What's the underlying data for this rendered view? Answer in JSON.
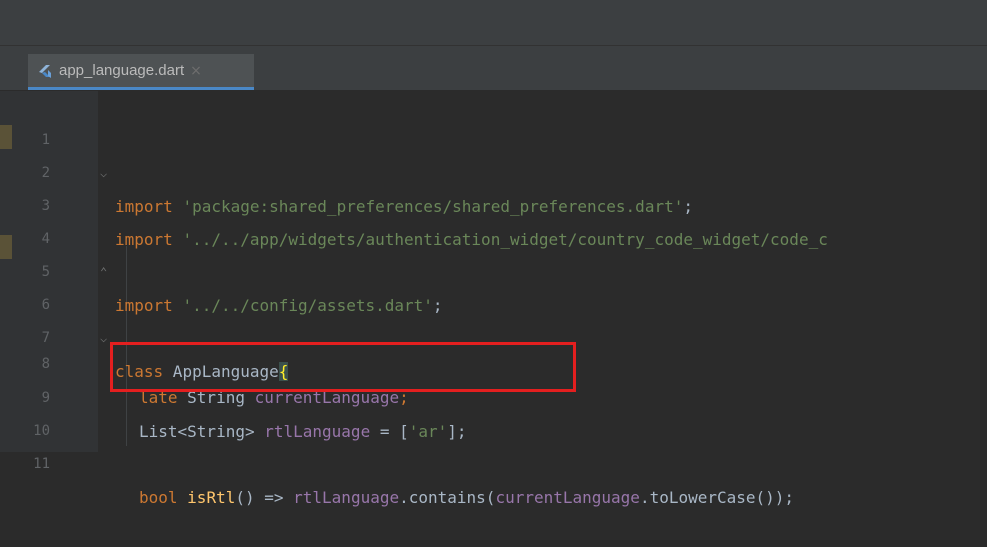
{
  "tab": {
    "filename": "app_language.dart",
    "close": "×",
    "icon": "flutter-dart-file-icon"
  },
  "lines": [
    {
      "n": "1"
    },
    {
      "n": "2"
    },
    {
      "n": "3"
    },
    {
      "n": "4"
    },
    {
      "n": "5"
    },
    {
      "n": "6"
    },
    {
      "n": "7"
    },
    {
      "n": "8"
    },
    {
      "n": "9"
    },
    {
      "n": "10"
    },
    {
      "n": "11"
    }
  ],
  "code": {
    "l1": {
      "kw": "import",
      "str": "'package:shared_preferences/shared_preferences.dart'",
      "end": ";"
    },
    "l3": {
      "kw": "import",
      "str": "'../../app/widgets/authentication_widget/country_code_widget/code_c"
    },
    "l4": {
      "kw": "import",
      "str": "'../../config/assets.dart'",
      "end": ";"
    },
    "l6": {
      "kw": "class",
      "name": " AppLanguage",
      "brace": "{"
    },
    "l8": {
      "kw": "late",
      "type": " String ",
      "fld": "currentLanguage",
      "end": ";"
    },
    "l9": {
      "type": "List<String> ",
      "fld": "rtlLanguage",
      "op": " = [",
      "str": "'ar'",
      "end": "];"
    },
    "l11": {
      "type": "bool ",
      "fn": "isRtl",
      "mid": "() => ",
      "fld1": "rtlLanguage",
      "call": ".contains(",
      "fld2": "currentLanguage",
      "end": ".toLowerCase());"
    }
  },
  "colors": {
    "keyword": "#cc7832",
    "string": "#6a8759",
    "field": "#9876aa",
    "function": "#ffc66d",
    "highlight_box": "#e41f1f"
  }
}
